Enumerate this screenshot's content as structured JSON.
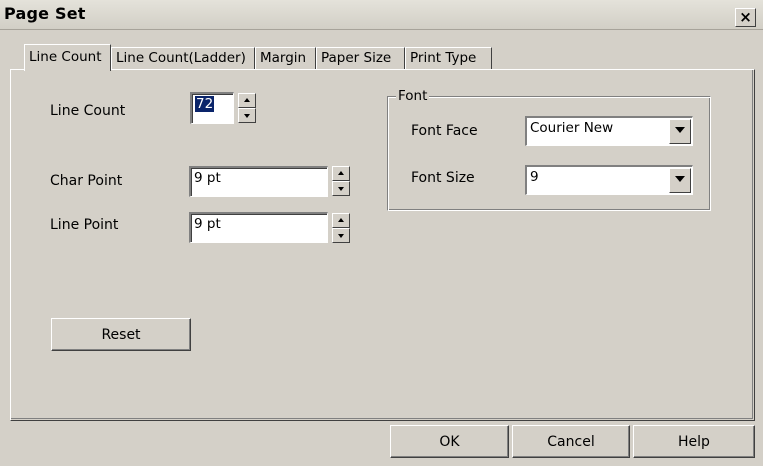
{
  "window": {
    "title": "Page Set",
    "close_glyph": "×"
  },
  "tabs": [
    {
      "label": "Line Count",
      "active": true
    },
    {
      "label": "Line Count(Ladder)",
      "active": false
    },
    {
      "label": "Margin",
      "active": false
    },
    {
      "label": "Paper Size",
      "active": false
    },
    {
      "label": "Print Type",
      "active": false
    }
  ],
  "form": {
    "line_count_label": "Line Count",
    "line_count_value": "72",
    "char_point_label": "Char Point",
    "char_point_value": "9 pt",
    "line_point_label": "Line Point",
    "line_point_value": "9 pt",
    "reset_label": "Reset"
  },
  "font_group": {
    "legend": "Font",
    "face_label": "Font Face",
    "face_value": "Courier New",
    "size_label": "Font Size",
    "size_value": "9"
  },
  "footer": {
    "ok_label": "OK",
    "cancel_label": "Cancel",
    "help_label": "Help"
  },
  "icons": {
    "spin_up": "spinner-up-arrow-icon",
    "spin_down": "spinner-down-arrow-icon",
    "dropdown": "dropdown-arrow-icon",
    "close": "close-icon"
  },
  "colors": {
    "dialog_face": "#d4d0c8",
    "selection": "#0a246a"
  }
}
